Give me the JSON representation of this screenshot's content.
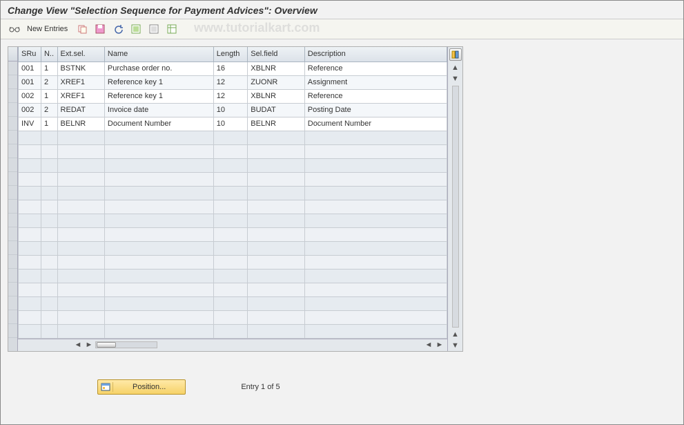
{
  "title": "Change View \"Selection Sequence for Payment Advices\": Overview",
  "toolbar": {
    "new_entries_label": "New Entries"
  },
  "watermark": "www.tutorialkart.com",
  "table": {
    "headers": {
      "sru": "SRu",
      "n": "N..",
      "ext": "Ext.sel.",
      "name": "Name",
      "length": "Length",
      "sel": "Sel.field",
      "desc": "Description"
    },
    "rows": [
      {
        "sru": "001",
        "n": "1",
        "ext": "BSTNK",
        "name": "Purchase order no.",
        "length": "16",
        "sel": "XBLNR",
        "desc": "Reference"
      },
      {
        "sru": "001",
        "n": "2",
        "ext": "XREF1",
        "name": "Reference key 1",
        "length": "12",
        "sel": "ZUONR",
        "desc": "Assignment"
      },
      {
        "sru": "002",
        "n": "1",
        "ext": "XREF1",
        "name": "Reference key 1",
        "length": "12",
        "sel": "XBLNR",
        "desc": "Reference"
      },
      {
        "sru": "002",
        "n": "2",
        "ext": "REDAT",
        "name": "Invoice date",
        "length": "10",
        "sel": "BUDAT",
        "desc": "Posting Date"
      },
      {
        "sru": "INV",
        "n": "1",
        "ext": "BELNR",
        "name": "Document Number",
        "length": "10",
        "sel": "BELNR",
        "desc": "Document Number"
      }
    ]
  },
  "footer": {
    "position_label": "Position...",
    "entry_text": "Entry 1 of 5"
  }
}
